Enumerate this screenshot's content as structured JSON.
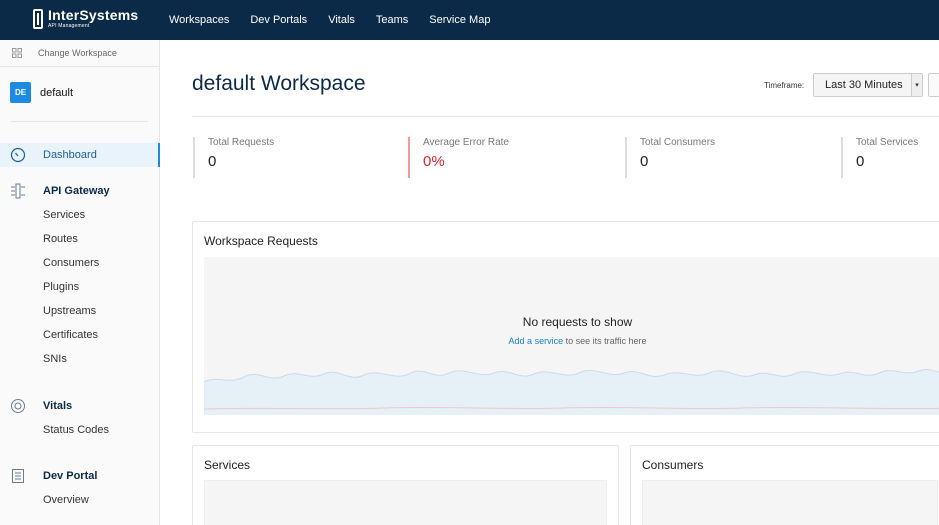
{
  "app": {
    "logo_name": "InterSystems",
    "logo_sub": "API Management"
  },
  "nav": [
    "Workspaces",
    "Dev Portals",
    "Vitals",
    "Teams",
    "Service Map"
  ],
  "sidebar": {
    "change_workspace": "Change Workspace",
    "workspace_badge": "DE",
    "workspace_name": "default",
    "workspace_badge_color": "#1b8ae0",
    "items": {
      "dashboard": "Dashboard",
      "api_gateway": "API Gateway",
      "services": "Services",
      "routes": "Routes",
      "consumers": "Consumers",
      "plugins": "Plugins",
      "upstreams": "Upstreams",
      "certificates": "Certificates",
      "snis": "SNIs",
      "vitals": "Vitals",
      "status_codes": "Status Codes",
      "dev_portal": "Dev Portal",
      "overview": "Overview"
    }
  },
  "main": {
    "title": "default Workspace",
    "timeframe_label": "Timeframe:",
    "timeframe_value": "Last 30 Minutes",
    "stats": [
      {
        "label": "Total Requests",
        "value": "0"
      },
      {
        "label": "Average Error Rate",
        "value": "0%"
      },
      {
        "label": "Total Consumers",
        "value": "0"
      },
      {
        "label": "Total Services",
        "value": "0"
      }
    ],
    "requests_panel": {
      "title": "Workspace Requests",
      "empty_title": "No requests to show",
      "empty_link": "Add a service",
      "empty_rest": " to see its traffic here"
    },
    "services_panel": {
      "title": "Services"
    },
    "consumers_panel": {
      "title": "Consumers"
    }
  },
  "colors": {
    "topbar": "#0b2a48",
    "accent": "#1b8ae0",
    "error": "#e0262f"
  }
}
